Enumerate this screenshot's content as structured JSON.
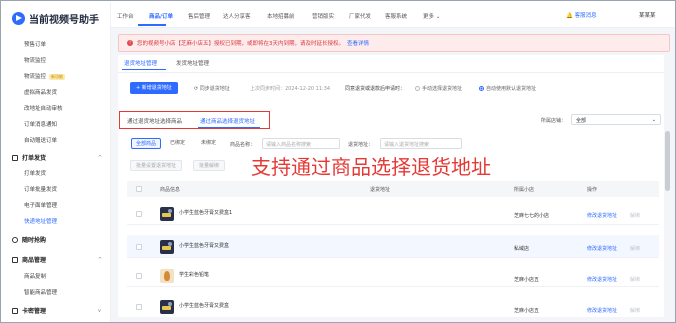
{
  "app": {
    "name": "当前视频号助手"
  },
  "top_nav": [
    "工作台",
    "商品/订单",
    "售后管理",
    "达人分享客",
    "本地招募前",
    "营销版实",
    "厂家代发",
    "客服系统",
    "更多"
  ],
  "top_nav_selected": 1,
  "top_right": {
    "support": "客服消息",
    "user": "某某某"
  },
  "sidebar": {
    "items_top": [
      {
        "label": "预售订单"
      },
      {
        "label": "物流监控"
      },
      {
        "label": "物流监控",
        "badge": "新功能"
      },
      {
        "label": "虚拟商品发货"
      },
      {
        "label": "改地址自动审核"
      },
      {
        "label": "订单消息通知"
      },
      {
        "label": "自动赠送订单"
      }
    ],
    "group_ship": {
      "title": "打单发货",
      "items": [
        "打单发货",
        "订单批量发货",
        "电子面单管理",
        "快递地址管理"
      ]
    },
    "group_recover": {
      "title": "随时抢购"
    },
    "group_goods": {
      "title": "商品管理",
      "items": [
        "商品复制",
        "智能商品管理"
      ]
    },
    "group_card": {
      "title": "卡密管理"
    }
  },
  "alert": {
    "text": "您的视频号小店【芝麻小店五】授权已到期，或即将在3天内到期，请及时延长授权。",
    "link": "查看详情"
  },
  "subtabs": [
    "退货地址管理",
    "发货地址管理"
  ],
  "toolbar": {
    "add_btn": "+ 新增退货地址",
    "sync_btn": "同步退货地址",
    "sync_time": "上次同步时间：2024-12-20 11:34",
    "rule_label": "同意退货或退款后申请时：",
    "opt_manual": "手动选择退货地址",
    "opt_auto": "自动使用默认退货地址"
  },
  "tabs2": [
    "通过退货地址选择商品",
    "通过商品选择退货地址"
  ],
  "shop_filter": {
    "label": "所属店铺：",
    "value": "全部"
  },
  "chips": [
    "全部商品",
    "已绑定",
    "未绑定"
  ],
  "filters": {
    "name_label": "商品名称：",
    "name_ph": "请输入商品名称搜索",
    "addr_label": "退货地址：",
    "addr_ph": "请输入退货地址搜索"
  },
  "batch_btns": [
    "批量设置退货地址",
    "批量解绑"
  ],
  "overlay": "支持通过商品选择退货地址",
  "table": {
    "headers": [
      "商品信息",
      "退货地址",
      "所属小店",
      "操作"
    ],
    "rows": [
      {
        "name": "小学生蓝色牙膏又费盒1",
        "shop": "芝麻七七的小店",
        "action": "修改退货地址",
        "del": "解绑",
        "thumb": "cam"
      },
      {
        "name": "小学生蓝色牙膏又费盒",
        "addr": "",
        "shop": "私域店",
        "action": "修改退货地址",
        "del": "解绑",
        "thumb": "cam"
      },
      {
        "name": "学生彩色铅笔",
        "shop": "芝麻小店五",
        "action": "修改退货地址",
        "del": "解绑",
        "thumb": "leaf"
      },
      {
        "name": "小学生蓝色牙膏又费盒",
        "shop": "芝麻小店五",
        "action": "修改退货地址",
        "del": "解绑",
        "thumb": "cam"
      }
    ]
  }
}
